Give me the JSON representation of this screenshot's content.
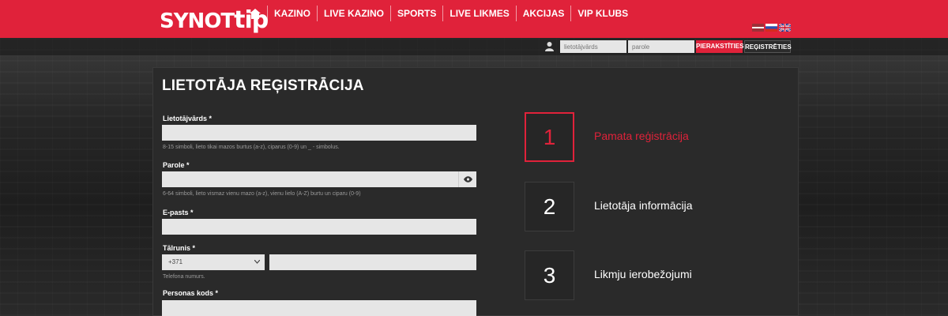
{
  "brand": {
    "logo_main": "SYNOT",
    "logo_tip": "tip"
  },
  "nav": {
    "items": [
      "KAZINO",
      "LIVE KAZINO",
      "SPORTS",
      "LIVE LIKMES",
      "AKCIJAS",
      "VIP KLUBS"
    ]
  },
  "languages": [
    "lv",
    "ru",
    "en"
  ],
  "login": {
    "username_placeholder": "lietotājvārds",
    "password_placeholder": "parole",
    "login_label": "PIERAKSTĪTIES",
    "register_label": "REĢISTRĒTIES"
  },
  "form": {
    "title": "LIETOTĀJA REĢISTRĀCIJA",
    "username_label": "Lietotājvārds *",
    "username_hint": "8-15 simboli, lieto tikai mazos burtus (a-z), ciparus (0-9) un _ - simbolus.",
    "password_label": "Parole *",
    "password_hint": "6-64 simboli, lieto vismaz vienu mazo (a-z), vienu lielo (A-Z) burtu un ciparu (0-9)",
    "email_label": "E-pasts *",
    "phone_label": "Tālrunis *",
    "phone_code": "+371",
    "phone_hint": "Telefona numurs.",
    "personal_code_label": "Personas kods *"
  },
  "steps": [
    {
      "number": "1",
      "label": "Pamata reģistrācija",
      "active": true
    },
    {
      "number": "2",
      "label": "Lietotāja informācija",
      "active": false
    },
    {
      "number": "3",
      "label": "Likmju ierobežojumi",
      "active": false
    }
  ],
  "colors": {
    "accent": "#e0223a",
    "panel": "#2a2a2a",
    "input": "#e6e6e6"
  }
}
